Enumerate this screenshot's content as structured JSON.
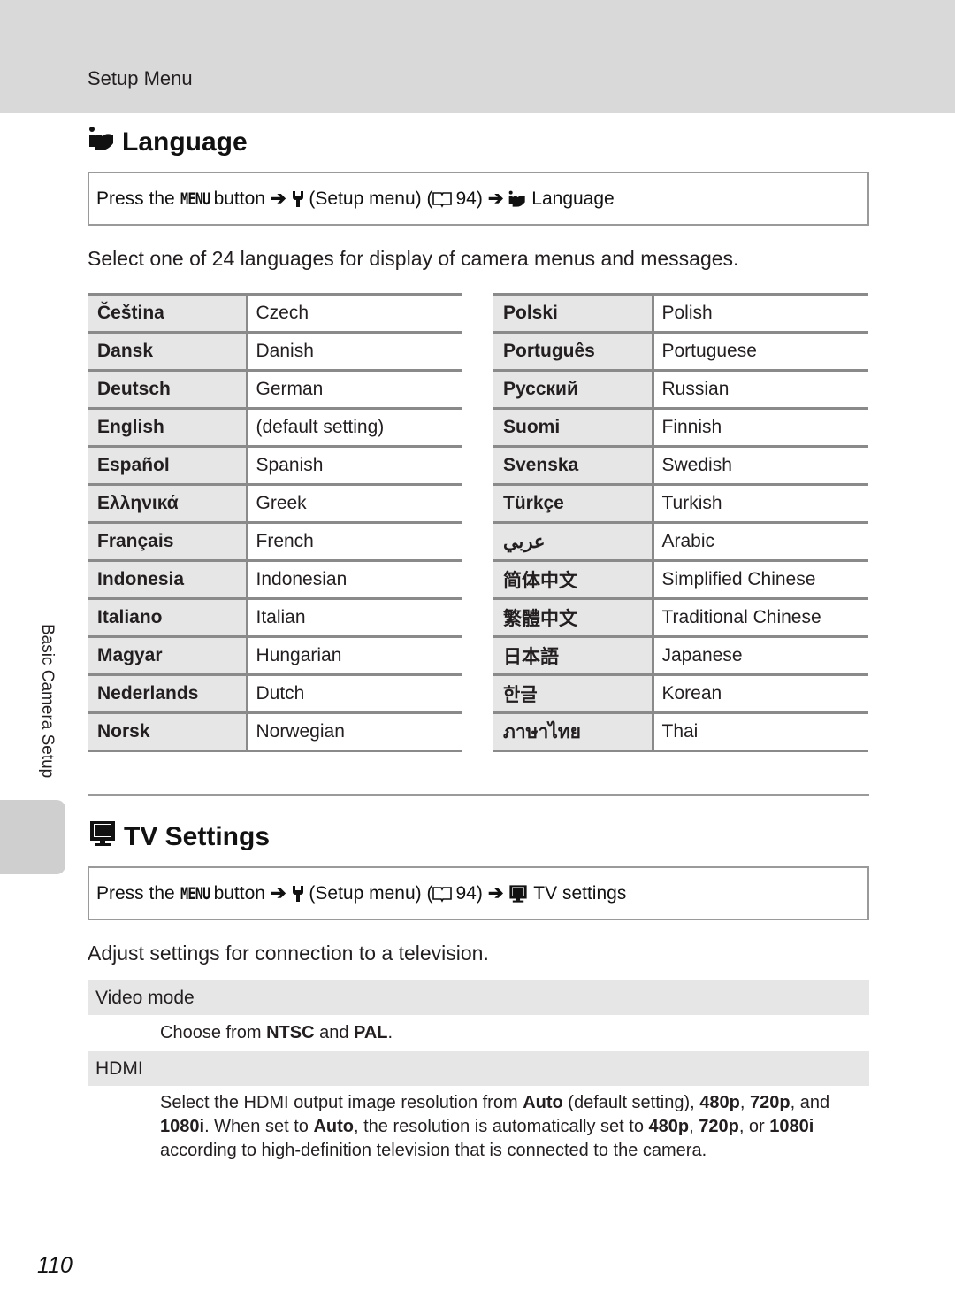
{
  "header": {
    "section": "Setup Menu"
  },
  "side_tab": {
    "label": "Basic Camera Setup"
  },
  "language": {
    "title": "Language",
    "title_icon": "language-icon",
    "path": {
      "prefix": "Press the",
      "menu_key": "MENU",
      "button_word": "button",
      "arrow": "➔",
      "setup_icon": "wrench-icon",
      "setup_label": "(Setup menu) (",
      "book_icon": "book-icon",
      "page_ref": "94)",
      "target_icon": "language-icon",
      "target": "Language"
    },
    "intro": "Select one of 24 languages for display of camera menus and messages.",
    "left_table": [
      {
        "native": "Čeština",
        "english": "Czech"
      },
      {
        "native": "Dansk",
        "english": "Danish"
      },
      {
        "native": "Deutsch",
        "english": "German"
      },
      {
        "native": "English",
        "english": "(default setting)"
      },
      {
        "native": "Español",
        "english": "Spanish"
      },
      {
        "native": "Ελληνικά",
        "english": "Greek"
      },
      {
        "native": "Français",
        "english": "French"
      },
      {
        "native": "Indonesia",
        "english": "Indonesian"
      },
      {
        "native": "Italiano",
        "english": "Italian"
      },
      {
        "native": "Magyar",
        "english": "Hungarian"
      },
      {
        "native": "Nederlands",
        "english": "Dutch"
      },
      {
        "native": "Norsk",
        "english": "Norwegian"
      }
    ],
    "right_table": [
      {
        "native": "Polski",
        "english": "Polish"
      },
      {
        "native": "Português",
        "english": "Portuguese"
      },
      {
        "native": "Русский",
        "english": "Russian"
      },
      {
        "native": "Suomi",
        "english": "Finnish"
      },
      {
        "native": "Svenska",
        "english": "Swedish"
      },
      {
        "native": "Türkçe",
        "english": "Turkish"
      },
      {
        "native": "عربي",
        "english": "Arabic"
      },
      {
        "native": "简体中文",
        "english": "Simplified Chinese"
      },
      {
        "native": "繁體中文",
        "english": "Traditional Chinese"
      },
      {
        "native": "日本語",
        "english": "Japanese"
      },
      {
        "native": "한글",
        "english": "Korean"
      },
      {
        "native": "ภาษาไทย",
        "english": "Thai"
      }
    ]
  },
  "tv_settings": {
    "title": "TV Settings",
    "title_icon": "tv-icon",
    "path": {
      "prefix": "Press the",
      "menu_key": "MENU",
      "button_word": "button",
      "arrow": "➔",
      "setup_label": "(Setup menu) (",
      "page_ref": "94)",
      "target": "TV settings"
    },
    "intro": "Adjust settings for connection to a television.",
    "options": [
      {
        "label": "Video mode",
        "desc_parts": [
          "Choose from ",
          "NTSC",
          " and ",
          "PAL",
          "."
        ]
      },
      {
        "label": "HDMI",
        "desc_parts": [
          "Select the HDMI output image resolution from ",
          "Auto",
          " (default setting), ",
          "480p",
          ", ",
          "720p",
          ", and ",
          "1080i",
          ". When set to ",
          "Auto",
          ", the resolution is automatically set to ",
          "480p",
          ", ",
          "720p",
          ", or ",
          "1080i",
          " according to high-definition television that is connected to the camera."
        ]
      }
    ]
  },
  "page_number": "110",
  "colors": {
    "band": "#d9d9d9",
    "cell_shade": "#e6e6e6",
    "rule": "#8a8a8a",
    "side_tab": "#cfcfcf"
  }
}
